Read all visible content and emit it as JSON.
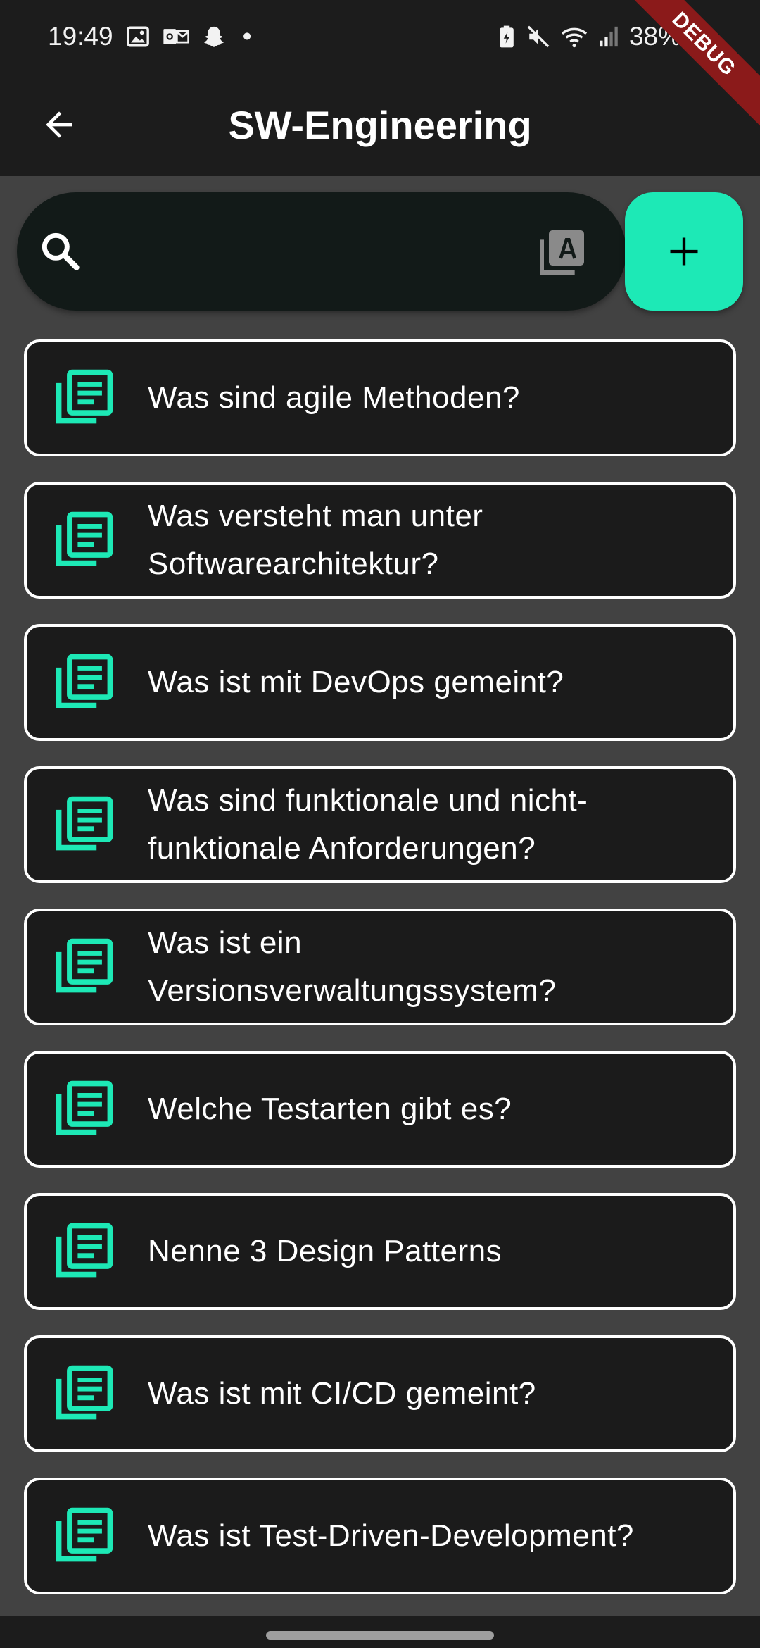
{
  "status_bar": {
    "time": "19:49",
    "battery": "38%",
    "dot": "•",
    "icons_left": [
      "gallery-icon",
      "outlook-icon",
      "snapchat-icon"
    ],
    "icons_right": [
      "battery-saver-icon",
      "mute-icon",
      "wifi-icon",
      "signal-icon"
    ]
  },
  "debug_banner": "DEBUG",
  "app_bar": {
    "title": "SW-Engineering",
    "back_icon": "arrow-back-icon"
  },
  "search": {
    "placeholder": "",
    "value": "",
    "search_icon": "search-icon",
    "trailing_icon": "translate-icon"
  },
  "add_button": {
    "icon": "plus-icon"
  },
  "colors": {
    "accent": "#1de9b6",
    "background": "#424242",
    "app_bar": "#1c1c1c",
    "card": "#1b1b1b",
    "card_border": "#ffffff",
    "search_field": "#121a18"
  },
  "questions": [
    {
      "label": "Was sind agile Methoden?",
      "icon": "library-books-icon"
    },
    {
      "label": "Was versteht man unter Softwarearchitektur?",
      "icon": "library-books-icon"
    },
    {
      "label": "Was ist mit DevOps gemeint?",
      "icon": "library-books-icon"
    },
    {
      "label": "Was sind funktionale und nicht-funktionale Anforderungen?",
      "icon": "library-books-icon"
    },
    {
      "label": "Was ist ein Versionsverwaltungssystem?",
      "icon": "library-books-icon"
    },
    {
      "label": "Welche Testarten gibt es?",
      "icon": "library-books-icon"
    },
    {
      "label": "Nenne 3 Design Patterns",
      "icon": "library-books-icon"
    },
    {
      "label": "Was ist mit CI/CD gemeint?",
      "icon": "library-books-icon"
    },
    {
      "label": "Was ist Test-Driven-Development?",
      "icon": "library-books-icon"
    }
  ]
}
